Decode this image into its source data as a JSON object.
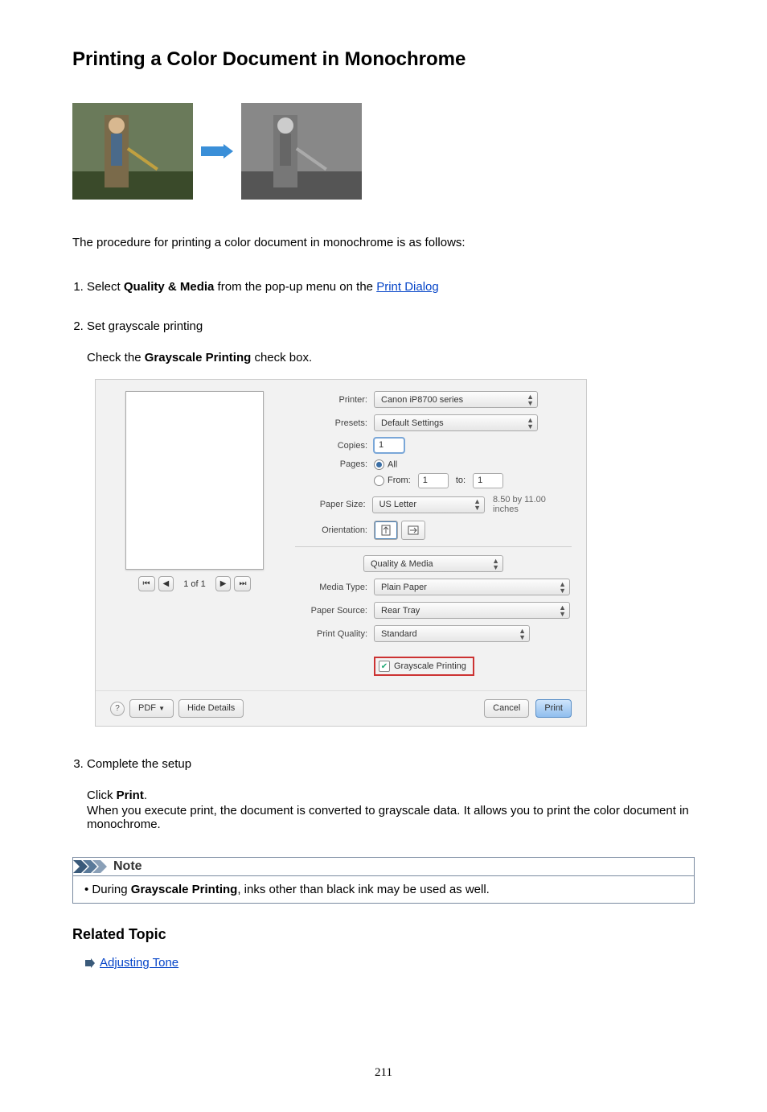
{
  "title": "Printing a Color Document in Monochrome",
  "intro": "The procedure for printing a color document in monochrome is as follows:",
  "steps": {
    "s1": {
      "prefix": "Select ",
      "bold": "Quality & Media",
      "suffix": " from the pop-up menu on the ",
      "link": "Print Dialog"
    },
    "s2": {
      "leader": "Set grayscale printing",
      "check_prefix": "Check the ",
      "check_bold": "Grayscale Printing",
      "check_suffix": " check box."
    },
    "s3": {
      "leader": "Complete the setup",
      "click_prefix": "Click ",
      "click_bold": "Print",
      "click_suffix": ".",
      "para": "When you execute print, the document is converted to grayscale data. It allows you to print the color document in monochrome."
    }
  },
  "dialog": {
    "printer_label": "Printer:",
    "printer_value": "Canon iP8700 series",
    "presets_label": "Presets:",
    "presets_value": "Default Settings",
    "copies_label": "Copies:",
    "copies_value": "1",
    "pages_label": "Pages:",
    "pages_all": "All",
    "pages_from_label": "From:",
    "pages_from_value": "1",
    "pages_to_label": "to:",
    "pages_to_value": "1",
    "papersize_label": "Paper Size:",
    "papersize_value": "US Letter",
    "papersize_dim": "8.50 by 11.00 inches",
    "orientation_label": "Orientation:",
    "section_label": "Quality & Media",
    "mediatype_label": "Media Type:",
    "mediatype_value": "Plain Paper",
    "papersource_label": "Paper Source:",
    "papersource_value": "Rear Tray",
    "printquality_label": "Print Quality:",
    "printquality_value": "Standard",
    "grayscale_label": "Grayscale Printing",
    "preview_pages": "1 of 1",
    "help": "?",
    "pdf_btn": "PDF",
    "hide_btn": "Hide Details",
    "cancel_btn": "Cancel",
    "print_btn": "Print"
  },
  "note": {
    "heading": "Note",
    "bullet_prefix": "During ",
    "bullet_bold": "Grayscale Printing",
    "bullet_suffix": ", inks other than black ink may be used as well."
  },
  "related": {
    "heading": "Related Topic",
    "link": "Adjusting Tone"
  },
  "page_number": "211"
}
